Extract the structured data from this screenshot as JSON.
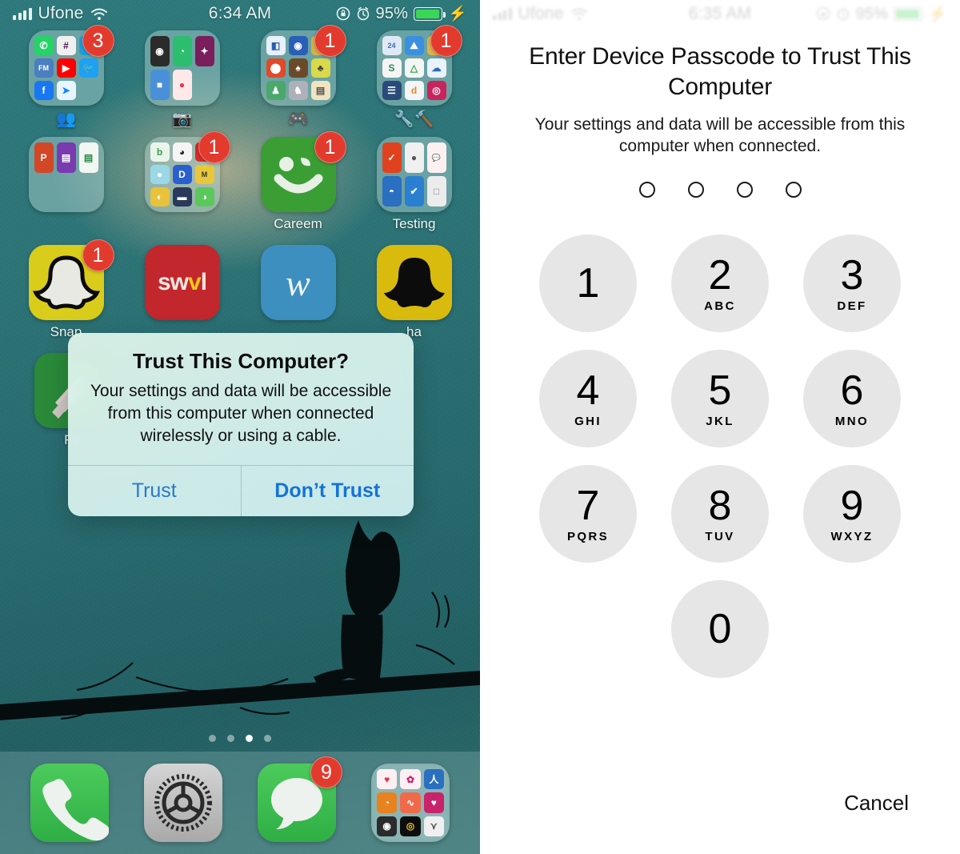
{
  "left_phone": {
    "status_bar": {
      "carrier": "Ufone",
      "wifi_icon": "wifi-icon",
      "signal_icon": "cellular-signal-icon",
      "time": "6:34 AM",
      "rotation_lock_icon": "rotation-lock-icon",
      "alarm_icon": "alarm-clock-icon",
      "battery_percent": "95%",
      "charging_icon": "lightning-bolt-icon",
      "battery_level": 95
    },
    "rows": [
      {
        "apps": [
          {
            "name": "social-folder",
            "type": "folder",
            "label": "👥",
            "badge": "3",
            "minis": [
              {
                "t": "✆",
                "bg": "#25d366"
              },
              {
                "t": "#",
                "bg": "#f0f0f0",
                "fg": "#4a154b"
              },
              {
                "t": "S",
                "bg": "#1aa0e0"
              },
              {
                "t": "FM",
                "bg": "#4a7fc1"
              },
              {
                "t": "▶",
                "bg": "#ff0000"
              },
              {
                "t": "🐦",
                "bg": "#1da1f2"
              },
              {
                "t": "f",
                "bg": "#1877f2"
              },
              {
                "t": "➤",
                "bg": "#e8f4ff",
                "fg": "#0084ff"
              }
            ]
          },
          {
            "name": "media-folder",
            "type": "folder",
            "label": "📷",
            "badge": "",
            "minis": [
              {
                "t": "◉",
                "bg": "#2b2b2b"
              },
              {
                "t": "◔",
                "bg": "#2dbd6e"
              },
              {
                "t": "✦",
                "bg": "#7b1e5c"
              },
              {
                "t": "■",
                "bg": "#4a90d9"
              },
              {
                "t": "●",
                "bg": "#ffe8ea",
                "fg": "#e0384a"
              },
              {
                "t": "",
                "bg": "transparent"
              }
            ]
          },
          {
            "name": "games-folder",
            "type": "folder",
            "label": "🎮",
            "badge": "1",
            "minis": [
              {
                "t": "◧",
                "bg": "#e8f0fb",
                "fg": "#2a5db0"
              },
              {
                "t": "◉",
                "bg": "#2a5fb8"
              },
              {
                "t": "♜",
                "bg": "#d9b24a"
              },
              {
                "t": "⬤",
                "bg": "#e04a2a"
              },
              {
                "t": "♠",
                "bg": "#6b4a2a"
              },
              {
                "t": "♣",
                "bg": "#d9d94a"
              },
              {
                "t": "♟",
                "bg": "#4aa86b"
              },
              {
                "t": "♞",
                "bg": "#b0b0b8"
              },
              {
                "t": "▤",
                "bg": "#f0e4c0"
              }
            ]
          },
          {
            "name": "utilities-folder",
            "type": "folder",
            "label": "🔧🔨",
            "badge": "1",
            "minis": [
              {
                "t": "24",
                "bg": "#dfe9f5",
                "fg": "#3a6fb0"
              },
              {
                "t": "⛰",
                "bg": "#3b8fe0"
              },
              {
                "t": "■",
                "bg": "#e0b44a"
              },
              {
                "t": "S",
                "bg": "#f5f5f5",
                "fg": "#2a8a5a"
              },
              {
                "t": "△",
                "bg": "#f5f5f5",
                "fg": "#2aa84a"
              },
              {
                "t": "☁",
                "bg": "#eaf2fb",
                "fg": "#2a6fb0"
              },
              {
                "t": "☰",
                "bg": "#2a4a7a"
              },
              {
                "t": "d",
                "bg": "#f5f5f5",
                "fg": "#e08a2a"
              },
              {
                "t": "◎",
                "bg": "#c8245c"
              }
            ]
          }
        ]
      },
      {
        "apps": [
          {
            "name": "office-folder",
            "type": "folder",
            "label": "",
            "badge": "",
            "minis": [
              {
                "t": "P",
                "bg": "#d24726"
              },
              {
                "t": "▤",
                "bg": "#7a3ab0"
              },
              {
                "t": "▤",
                "bg": "#f2f7f2",
                "fg": "#2a8a4a"
              },
              {
                "t": "",
                "bg": "transparent"
              },
              {
                "t": "",
                "bg": "transparent"
              },
              {
                "t": "",
                "bg": "transparent"
              }
            ]
          },
          {
            "name": "learning-folder",
            "type": "folder",
            "label": "",
            "badge": "1",
            "minis": [
              {
                "t": "b",
                "bg": "#eaf5ea",
                "fg": "#3a9a4a"
              },
              {
                "t": "◕",
                "bg": "#f5f5f5",
                "fg": "#222"
              },
              {
                "t": "■",
                "bg": "#d92a2a"
              },
              {
                "t": "●",
                "bg": "#9ad8e8"
              },
              {
                "t": "D",
                "bg": "#2a5fd0"
              },
              {
                "t": "M",
                "bg": "#e8c83a",
                "fg": "#333"
              },
              {
                "t": "◐",
                "bg": "#e8c23a"
              },
              {
                "t": "▬",
                "bg": "#2a3a5a"
              },
              {
                "t": "◑",
                "bg": "#5ac85a"
              }
            ]
          },
          {
            "name": "careem-app",
            "type": "app",
            "label": "Careem",
            "badge": "1",
            "icon": "careem-smiley-icon",
            "bg": "#3a9e34"
          },
          {
            "name": "testing-folder",
            "type": "folder",
            "label": "Testing",
            "badge": "",
            "minis": [
              {
                "t": "✓",
                "bg": "#e0421f"
              },
              {
                "t": "●",
                "bg": "#f0f0f0",
                "fg": "#555"
              },
              {
                "t": "💬",
                "bg": "#fdf0f0",
                "fg": "#e0324a"
              },
              {
                "t": "◓",
                "bg": "#2a6fc0"
              },
              {
                "t": "✔",
                "bg": "#2a7fd0"
              },
              {
                "t": "□",
                "bg": "#ececec",
                "fg": "#888"
              }
            ]
          }
        ]
      },
      {
        "apps": [
          {
            "name": "snapchat-app",
            "type": "app",
            "label": "Snap",
            "badge": "1",
            "icon": "snapchat-ghost-icon",
            "bg": "#d9cc1a"
          },
          {
            "name": "swvl-app",
            "type": "app",
            "label": "",
            "badge": "",
            "icon": "swvl-wordmark",
            "bg": "#c1272d"
          },
          {
            "name": "wish-app",
            "type": "app",
            "label": "",
            "badge": "",
            "icon": "wish-w-icon",
            "bg": "#3d8fc0"
          },
          {
            "name": "snapchat-dark-app",
            "type": "app",
            "label": "ha",
            "badge": "",
            "icon": "snapchat-ghost-dark-icon",
            "bg": "#d9bb0e"
          }
        ]
      },
      {
        "apps": [
          {
            "name": "feedly-app",
            "type": "app",
            "label": "Fe",
            "badge": "",
            "icon": "feedly-icon",
            "bg": "#2a8a3a"
          }
        ]
      }
    ],
    "page_dots": {
      "count": 4,
      "active_index": 2
    },
    "dock": [
      {
        "name": "phone-app",
        "icon": "phone-handset-icon",
        "bg": "#3fbf52",
        "badge": ""
      },
      {
        "name": "settings-app",
        "icon": "gear-icon",
        "bg": "#b8b8b8",
        "badge": ""
      },
      {
        "name": "messages-app",
        "icon": "speech-bubble-icon",
        "bg": "#3fbf52",
        "badge": "9"
      },
      {
        "name": "health-folder",
        "icon": "health-folder-icon",
        "bg": "rgba(190,225,222,0.42)",
        "badge": ""
      }
    ],
    "dialog": {
      "title": "Trust This Computer?",
      "message": "Your settings and data will be accessible from this computer when connected wirelessly or using a cable.",
      "trust_label": "Trust",
      "dont_trust_label": "Don’t Trust",
      "trust_color": "#2a79c9",
      "dont_trust_color": "#1573d6"
    }
  },
  "right_phone": {
    "status_bar": {
      "carrier": "Ufone",
      "time": "6:35 AM",
      "battery_percent": "95%",
      "signal_icon": "cellular-signal-icon",
      "wifi_icon": "wifi-icon",
      "rotation_lock_icon": "rotation-lock-icon",
      "alarm_icon": "alarm-clock-icon",
      "charging_icon": "lightning-bolt-icon"
    },
    "passcode": {
      "title": "Enter Device Passcode to Trust This Computer",
      "subtitle": "Your settings and data will be accessible from this computer when connected.",
      "dots_total": 4,
      "dots_filled": 0,
      "cancel_label": "Cancel",
      "keys": [
        {
          "num": "1",
          "letters": ""
        },
        {
          "num": "2",
          "letters": "ABC"
        },
        {
          "num": "3",
          "letters": "DEF"
        },
        {
          "num": "4",
          "letters": "GHI"
        },
        {
          "num": "5",
          "letters": "JKL"
        },
        {
          "num": "6",
          "letters": "MNO"
        },
        {
          "num": "7",
          "letters": "PQRS"
        },
        {
          "num": "8",
          "letters": "TUV"
        },
        {
          "num": "9",
          "letters": "WXYZ"
        },
        {
          "num": "0",
          "letters": ""
        }
      ]
    }
  }
}
